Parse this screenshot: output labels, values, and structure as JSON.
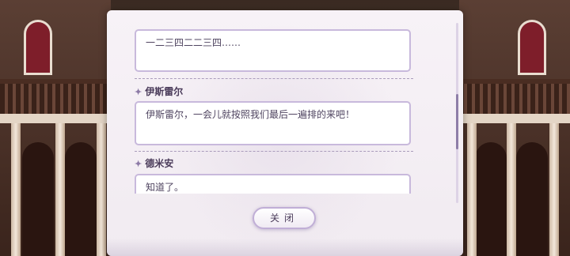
{
  "dialog_log": {
    "entries": [
      {
        "speaker": "",
        "text": "一二三四二二三四……"
      },
      {
        "speaker": "伊斯雷尔",
        "text": "伊斯雷尔，一会儿就按照我们最后一遍排的来吧！"
      },
      {
        "speaker": "德米安",
        "text": "知道了。"
      }
    ],
    "star_glyph": "✦"
  },
  "close_button": {
    "label": "关闭"
  },
  "colors": {
    "panel": "#f7f2f7",
    "bubble_border": "#c8b9dc",
    "text": "#4f4460",
    "scroll_thumb": "#8e7ea8"
  }
}
